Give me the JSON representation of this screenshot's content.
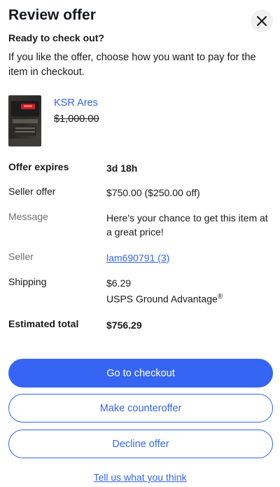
{
  "dialog": {
    "title": "Review offer",
    "close_icon": "close-icon",
    "subtitle": "Ready to check out?",
    "intro": "If you like the offer, choose how you want to pay for the item in checkout."
  },
  "item": {
    "name": "KSR Ares",
    "original_price": "$1,000.00",
    "thumbnail": "product-photo"
  },
  "details": {
    "offer_expires_label": "Offer expires",
    "offer_expires_value": "3d 18h",
    "seller_offer_label": "Seller offer",
    "seller_offer_value": "$750.00 ($250.00 off)",
    "message_label": "Message",
    "message_value": "Here's your chance to get this item at a great price!",
    "seller_label": "Seller",
    "seller_value": "lam690791 (3)",
    "shipping_label": "Shipping",
    "shipping_cost": "$6.29",
    "shipping_method": "USPS Ground Advantage",
    "shipping_mark": "®",
    "total_label": "Estimated total",
    "total_value": "$756.29"
  },
  "actions": {
    "checkout": "Go to checkout",
    "counteroffer": "Make counteroffer",
    "decline": "Decline offer",
    "feedback": "Tell us what you think"
  },
  "colors": {
    "accent": "#3665f3",
    "muted_text": "#707070",
    "text": "#191919"
  }
}
